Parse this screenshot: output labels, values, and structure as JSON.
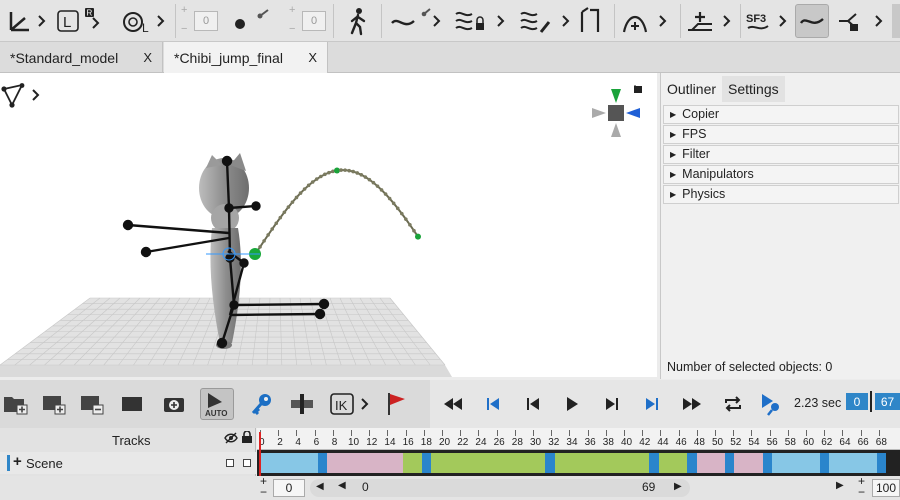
{
  "toolbar": {
    "numbox1": "0",
    "numbox2": "0",
    "plus": "+",
    "minus": "−",
    "sf3": "SF3"
  },
  "tabs": [
    {
      "label": "*Standard_model",
      "close": "X"
    },
    {
      "label": "*Chibi_jump_final",
      "close": "X"
    }
  ],
  "panel": {
    "tabs": [
      "Outliner",
      "Settings"
    ],
    "items": [
      "Copier",
      "FPS",
      "Filter",
      "Manipulators",
      "Physics"
    ],
    "status": "Number of selected objects: 0"
  },
  "transport": {
    "time": "2.23 sec",
    "frame_start": "0",
    "frame_current": "67"
  },
  "tracks": {
    "header": "Tracks",
    "scene": "Scene",
    "plus": "+",
    "ticks": [
      "0",
      "2",
      "4",
      "6",
      "8",
      "10",
      "12",
      "14",
      "16",
      "18",
      "20",
      "22",
      "24",
      "26",
      "28",
      "30",
      "32",
      "34",
      "36",
      "38",
      "40",
      "42",
      "44",
      "46",
      "48",
      "50",
      "52",
      "54",
      "56",
      "58",
      "60",
      "62",
      "64",
      "66",
      "68"
    ],
    "segments": [
      {
        "color": "#87c7e6",
        "frames": 6
      },
      {
        "color": "#2a85cc",
        "frames": 1
      },
      {
        "color": "#d8b4c6",
        "frames": 8
      },
      {
        "color": "#a3c95b",
        "frames": 2
      },
      {
        "color": "#2a85cc",
        "frames": 1
      },
      {
        "color": "#a3c95b",
        "frames": 12
      },
      {
        "color": "#2a85cc",
        "frames": 1
      },
      {
        "color": "#a3c95b",
        "frames": 10
      },
      {
        "color": "#2a85cc",
        "frames": 1
      },
      {
        "color": "#a3c95b",
        "frames": 3
      },
      {
        "color": "#2a85cc",
        "frames": 1
      },
      {
        "color": "#d8b4c6",
        "frames": 3
      },
      {
        "color": "#2a85cc",
        "frames": 1
      },
      {
        "color": "#d8b4c6",
        "frames": 3
      },
      {
        "color": "#2a85cc",
        "frames": 1
      },
      {
        "color": "#87c7e6",
        "frames": 5
      },
      {
        "color": "#2a85cc",
        "frames": 1
      },
      {
        "color": "#87c7e6",
        "frames": 5
      },
      {
        "color": "#2a85cc",
        "frames": 1
      }
    ]
  },
  "bottom": {
    "start": "0",
    "scroll_left": "0",
    "scroll_right": "69",
    "zoom": "100",
    "plus": "+",
    "minus": "−"
  }
}
